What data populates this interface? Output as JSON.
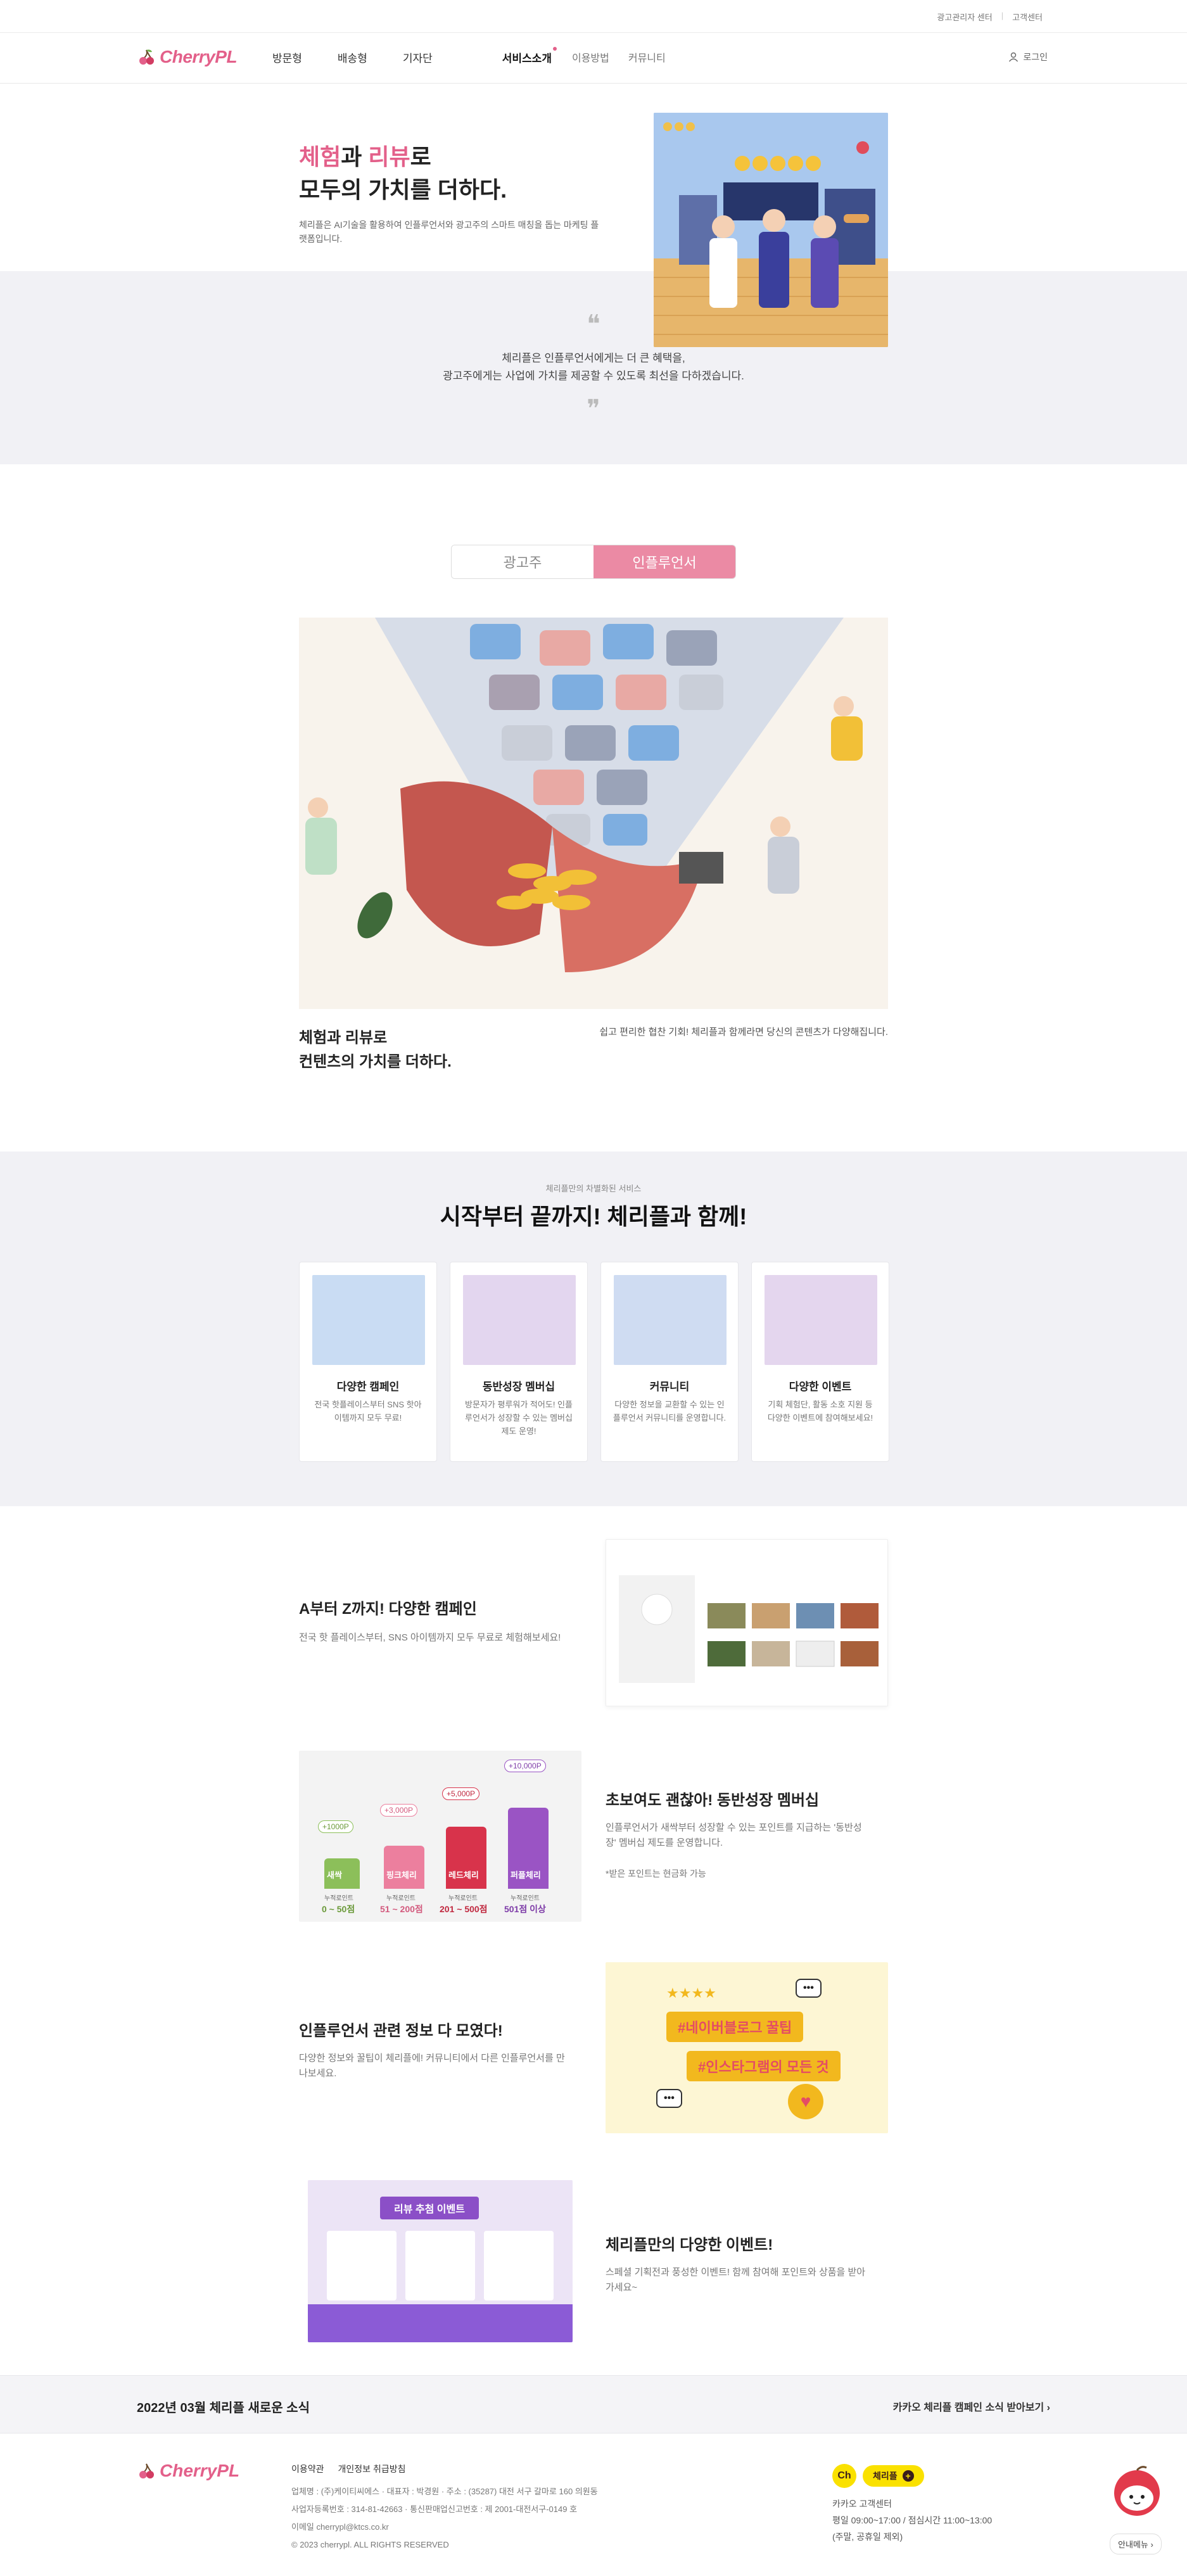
{
  "topbar": {
    "links": [
      "광고관리자 센터",
      "고객센터"
    ]
  },
  "header": {
    "logo": "CherryPL",
    "nav": [
      "방문형",
      "배송형",
      "기자단",
      "서비스소개",
      "이용방법",
      "커뮤니티"
    ],
    "login": "로그인"
  },
  "hero": {
    "title_pink1": "체험",
    "title_mid": "과 ",
    "title_pink2": "리뷰",
    "title_end": "로",
    "title_line2": "모두의 가치를 더하다.",
    "desc": "체리플은 AI기술을 활용하여 인플루언서와 광고주의 스마트 매칭을 돕는 마케팅 플랫폼입니다."
  },
  "quote": {
    "line1": "체리플은 인플루언서에게는 더 큰 혜택을,",
    "line2": "광고주에게는 사업에 가치를 제공할 수 있도록 최선을 다하겠습니다."
  },
  "toggle": {
    "left": "광고주",
    "right": "인플루언서"
  },
  "illustration": {
    "title_line1": "체험과 리뷰로",
    "title_line2": "컨텐츠의 가치를 더하다.",
    "desc": "쉽고 편리한 협찬 기회! 체리플과 함께라면 당신의 콘텐츠가 다양해집니다."
  },
  "services": {
    "eyebrow": "체리플만의 차별화된 서비스",
    "title": "시작부터 끝까지! 체리플과 함께!",
    "cards": [
      {
        "title": "다양한 캠페인",
        "desc": "전국 핫플레이스부터 SNS 핫아이템까지 모두 무료!",
        "color": "#c9dcf3"
      },
      {
        "title": "동반성장 멤버십",
        "desc": "방문자가 평루워가 적어도! 인플루언서가 성장할 수 있는 멤버십 제도 운영!",
        "color": "#e3d6ef"
      },
      {
        "title": "커뮤니티",
        "desc": "다양한 정보을 교환할 수 있는 인플루언서 커뮤니티를 운영합니다.",
        "color": "#cfdcf2"
      },
      {
        "title": "다양한 이벤트",
        "desc": "기획 체험단, 활동 소호 지원 등 다양한 이벤트에 참여해보세요!",
        "color": "#e4d6ee"
      }
    ]
  },
  "features": [
    {
      "title": "A부터 Z까지! 다양한 캠페인",
      "desc": "전국 핫 플레이스부터, SNS 아이템까지 모두 무료로 체험해보세요!",
      "img_label": "캠페인 목록"
    },
    {
      "title": "초보여도 괜찮아! 동반성장 멤버십",
      "desc": "인플루언서가 새싹부터 성장할 수 있는 포인트를 지급하는 '동반성장' 멤버십 제도를 운영합니다.",
      "note": "*받은 포인트는 현금화 가능"
    },
    {
      "title": "인플루언서 관련 정보 다 모였다!",
      "desc": "다양한 정보와 꿀팁이 체리플에! 커뮤니티에서 다른 인플루언서를 만나보세요.",
      "tag1": "#네이버블로그 꿀팁",
      "tag2": "#인스타그램의 모든 것"
    },
    {
      "title": "체리플만의 다양한 이벤트!",
      "desc": "스페셜 기획전과 풍성한 이벤트! 함께 참여해 포인트와 상품을 받아가세요~",
      "banner": "리뷰 추첨 이벤트"
    }
  ],
  "membership": {
    "levels": [
      {
        "name": "새싹",
        "point": "+1000P",
        "label": "누적로인트",
        "range": "0 ~ 50점",
        "color": "#8cbf5a"
      },
      {
        "name": "핑크체리",
        "point": "+3,000P",
        "label": "누적로인트",
        "range": "51 ~ 200점",
        "color": "#ec7f9e"
      },
      {
        "name": "레드체리",
        "point": "+5,000P",
        "label": "누적로인트",
        "range": "201 ~ 500점",
        "color": "#d8334b"
      },
      {
        "name": "퍼플체리",
        "point": "+10,000P",
        "label": "누적로인트",
        "range": "501점 이상",
        "color": "#9a54c4"
      }
    ]
  },
  "news": {
    "left": "2022년 03월 체리플 새로운 소식",
    "right": "카카오 체리플 캠페인 소식 받아보기 ›"
  },
  "footer": {
    "logo": "CherryPL",
    "links": [
      "이용약관",
      "개인정보 취급방침"
    ],
    "info1": "업체명 : (주)케이티씨에스  ·  대표자 : 박경원  ·  주소 : (35287) 대전 서구 갈마로 160 의원동",
    "info2": "사업자등록번호 : 314-81-42663  ·  통신판매업신고번호 : 제 2001-대전서구-0149 호",
    "info3": "이메일 cherrypl@ktcs.co.kr",
    "copyright": "© 2023 cherrypl. ALL RIGHTS RESERVED",
    "kakao_ch": "Ch",
    "kakao_pill": "체리플",
    "cs_title": "카카오 고객센터",
    "cs_hours": "평일 09:00~17:00 / 점심시간 11:00~13:00",
    "cs_note": "(주말, 공휴일 제외)",
    "guide": "안내메뉴 ›"
  }
}
